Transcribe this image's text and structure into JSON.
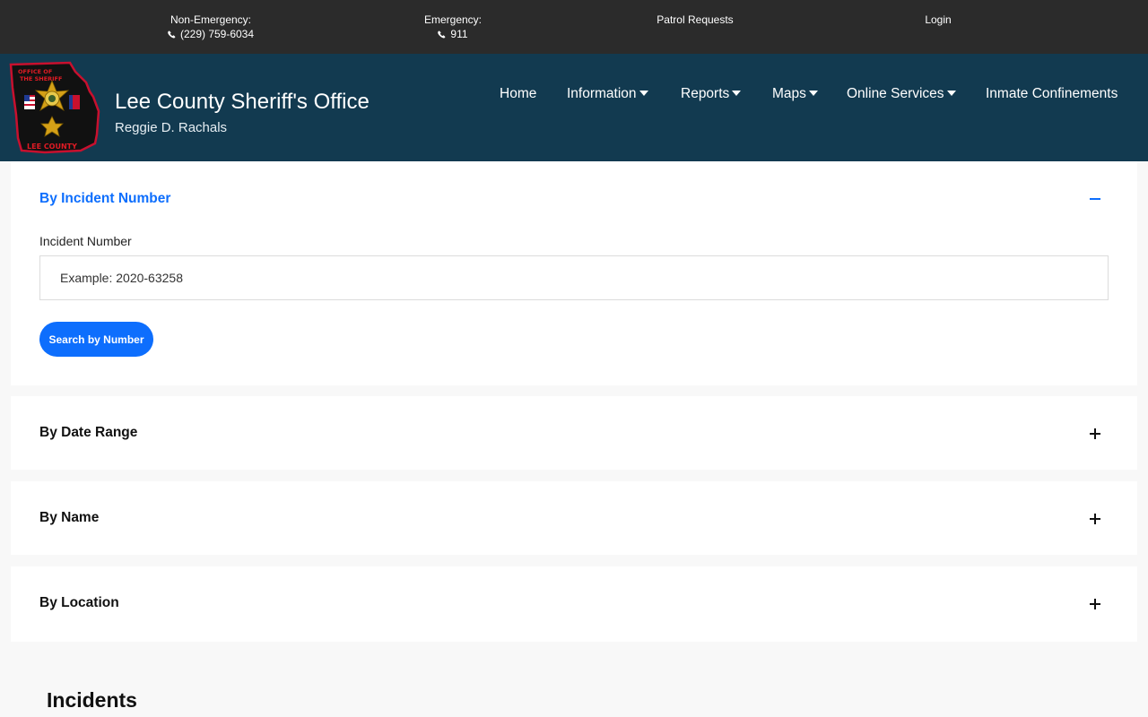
{
  "topbar": {
    "non_emergency_label": "Non-Emergency:",
    "non_emergency_phone": "(229) 759-6034",
    "emergency_label": "Emergency:",
    "emergency_phone": "911",
    "patrol_requests": "Patrol Requests",
    "login": "Login"
  },
  "header": {
    "logo_text_top": "OFFICE OF THE SHERIFF",
    "logo_text_bottom": "LEE COUNTY",
    "title": "Lee County Sheriff's Office",
    "subtitle": "Reggie D. Rachals",
    "nav": {
      "home": "Home",
      "information": "Information",
      "reports": "Reports",
      "maps": "Maps",
      "online_services": "Online Services",
      "inmate_confinements": "Inmate Confinements"
    }
  },
  "search_panels": {
    "by_incident_number": {
      "title": "By Incident Number",
      "expanded": true,
      "field_label": "Incident Number",
      "placeholder": "Example: 2020-63258",
      "value": "",
      "button": "Search by Number"
    },
    "by_date_range": {
      "title": "By Date Range",
      "expanded": false
    },
    "by_name": {
      "title": "By Name",
      "expanded": false
    },
    "by_location": {
      "title": "By Location",
      "expanded": false
    }
  },
  "incidents": {
    "heading": "Incidents"
  },
  "colors": {
    "topbar_bg": "#2b2b2b",
    "header_bg": "#123a50",
    "accent": "#0d6efd",
    "page_bg": "#f8f8f8"
  },
  "icons": [
    "phone-icon",
    "chevron-down-icon",
    "minus-icon",
    "plus-icon",
    "sheriff-badge-logo"
  ]
}
